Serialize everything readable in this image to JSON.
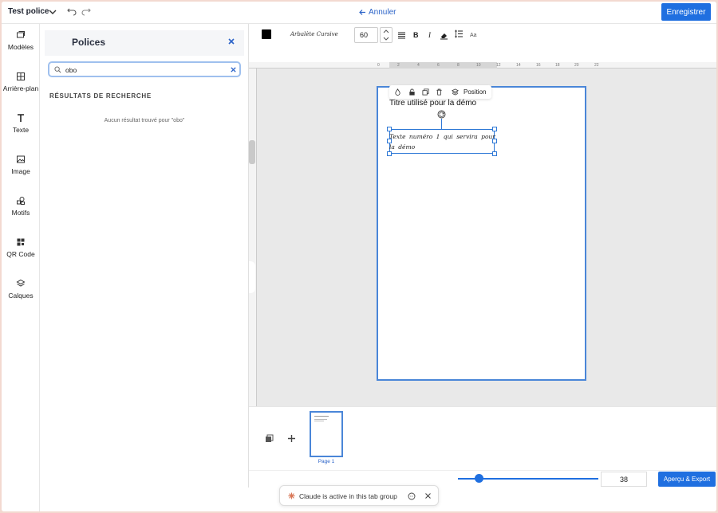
{
  "header": {
    "doc_title": "Test police",
    "cancel_label": "Annuler",
    "save_label": "Enregistrer"
  },
  "nav": {
    "items": [
      {
        "label": "Modèles",
        "icon": "templates-icon"
      },
      {
        "label": "Arrière-plan",
        "icon": "background-icon"
      },
      {
        "label": "Texte",
        "icon": "text-icon"
      },
      {
        "label": "Image",
        "icon": "image-icon"
      },
      {
        "label": "Motifs",
        "icon": "shapes-icon"
      },
      {
        "label": "QR Code",
        "icon": "qr-code-icon"
      },
      {
        "label": "Calques",
        "icon": "layers-icon"
      }
    ]
  },
  "fonts_panel": {
    "title": "Polices",
    "search_value": "obo",
    "results_heading": "RÉSULTATS DE RECHERCHE",
    "no_results": "Aucun résultat trouvé pour \"obo\""
  },
  "toolbar": {
    "color": "#000000",
    "font_name": "Arbalète Cursive",
    "font_size": "60",
    "bold_label": "B",
    "italic_label": "I",
    "case_label": "Aa"
  },
  "ruler": {
    "top_ticks": [
      "0",
      "2",
      "4",
      "6",
      "8",
      "10",
      "12",
      "14",
      "16",
      "18",
      "20",
      "22"
    ]
  },
  "canvas": {
    "position_label": "Position",
    "title_text": "Titre utilisé pour la démo",
    "script_text": "Texte numéro 1 qui servira pour la démo"
  },
  "pages": {
    "page_label": "Page 1"
  },
  "bottom": {
    "zoom_value": "38",
    "zoom_fraction": 0.15,
    "export_label": "Aperçu & Export"
  },
  "claude_bar": {
    "text": "Claude is active in this tab group"
  },
  "colors": {
    "accent": "#1f6fe0",
    "selection": "#2e78d6"
  }
}
